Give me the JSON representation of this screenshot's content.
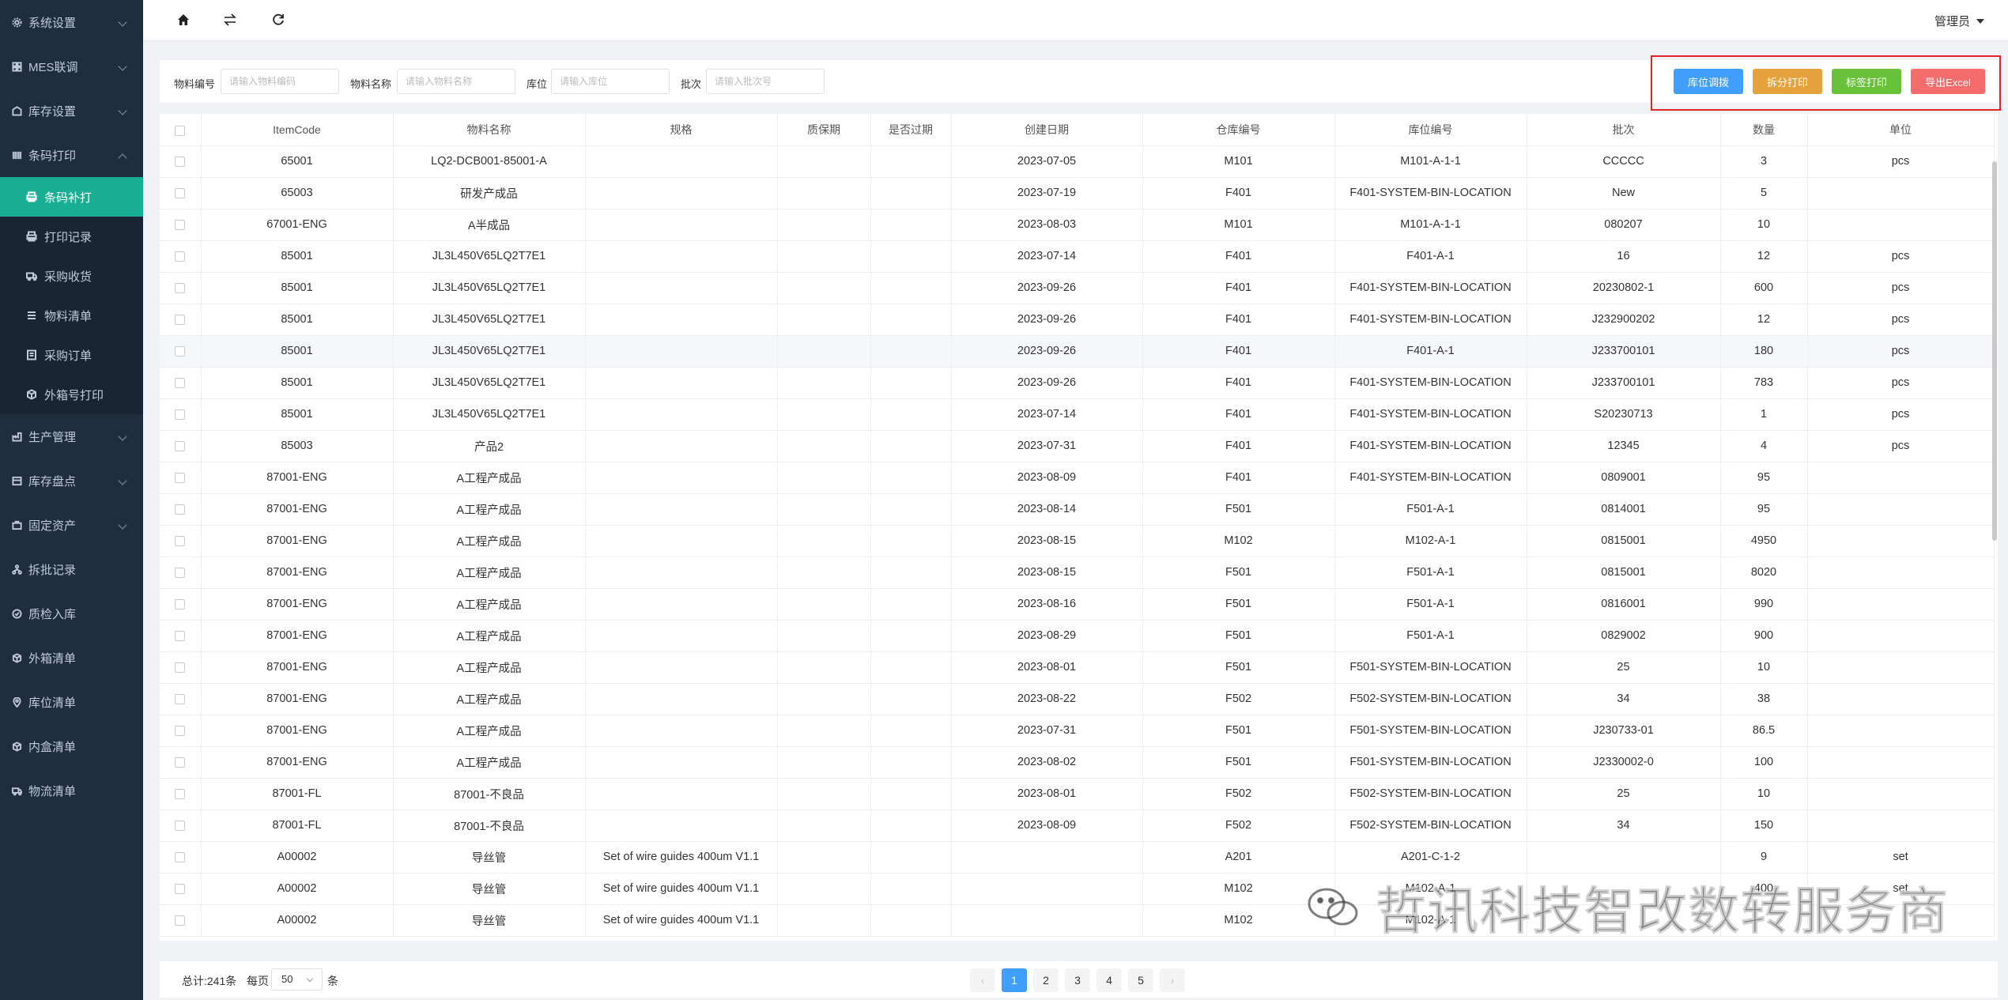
{
  "sidebar": {
    "items": [
      {
        "label": "系统设置",
        "icon": "gear-icon"
      },
      {
        "label": "MES联调",
        "icon": "grid-icon"
      },
      {
        "label": "库存设置",
        "icon": "store-icon"
      },
      {
        "label": "条码打印",
        "icon": "barcode-icon"
      },
      {
        "label": "条码补打",
        "icon": "print-icon",
        "sub": true,
        "active": true
      },
      {
        "label": "打印记录",
        "icon": "print-icon",
        "sub": true
      },
      {
        "label": "采购收货",
        "icon": "truck-icon",
        "sub": true
      },
      {
        "label": "物料清单",
        "icon": "list-icon",
        "sub": true
      },
      {
        "label": "采购订单",
        "icon": "order-icon",
        "sub": true
      },
      {
        "label": "外箱号打印",
        "icon": "box-icon",
        "sub": true
      },
      {
        "label": "生产管理",
        "icon": "factory-icon"
      },
      {
        "label": "库存盘点",
        "icon": "inventory-icon"
      },
      {
        "label": "固定资产",
        "icon": "asset-icon"
      },
      {
        "label": "拆批记录",
        "icon": "split-icon"
      },
      {
        "label": "质检入库",
        "icon": "check-icon"
      },
      {
        "label": "外箱清单",
        "icon": "box-icon"
      },
      {
        "label": "库位清单",
        "icon": "location-icon"
      },
      {
        "label": "内盒清单",
        "icon": "cube-icon"
      },
      {
        "label": "物流清单",
        "icon": "truck-icon"
      }
    ]
  },
  "topbar": {
    "icons": [
      "home-icon",
      "switch-icon",
      "refresh-icon"
    ],
    "user": "管理员"
  },
  "filters": {
    "code_label": "物料编号",
    "code_placeholder": "请输入物料编码",
    "name_label": "物料名称",
    "name_placeholder": "请输入物料名称",
    "loc_label": "库位",
    "loc_placeholder": "请输入库位",
    "batch_label": "批次",
    "batch_placeholder": "请输入批次号"
  },
  "buttons": {
    "transfer": "库位调拨",
    "split_print": "拆分打印",
    "label_print": "标签打印",
    "export": "导出Excel"
  },
  "colors": {
    "transfer": "#409eff",
    "split_print": "#e6a23c",
    "label_print": "#67c23a",
    "export": "#f56c6c",
    "sidebar_bg": "#1f2d3d",
    "active": "#1aae94",
    "highlight": "#e0262b"
  },
  "table": {
    "columns": [
      "ItemCode",
      "物料名称",
      "规格",
      "质保期",
      "是否过期",
      "创建日期",
      "仓库编号",
      "库位编号",
      "批次",
      "数量",
      "单位"
    ],
    "rows": [
      [
        "65001",
        "LQ2-DCB001-85001-A",
        "",
        "",
        "",
        "2023-07-05",
        "M101",
        "M101-A-1-1",
        "CCCCC",
        "3",
        "pcs"
      ],
      [
        "65003",
        "研发产成品",
        "",
        "",
        "",
        "2023-07-19",
        "F401",
        "F401-SYSTEM-BIN-LOCATION",
        "New",
        "5",
        ""
      ],
      [
        "67001-ENG",
        "A半成品",
        "",
        "",
        "",
        "2023-08-03",
        "M101",
        "M101-A-1-1",
        "080207",
        "10",
        ""
      ],
      [
        "85001",
        "JL3L450V65LQ2T7E1",
        "",
        "",
        "",
        "2023-07-14",
        "F401",
        "F401-A-1",
        "16",
        "12",
        "pcs"
      ],
      [
        "85001",
        "JL3L450V65LQ2T7E1",
        "",
        "",
        "",
        "2023-09-26",
        "F401",
        "F401-SYSTEM-BIN-LOCATION",
        "20230802-1",
        "600",
        "pcs"
      ],
      [
        "85001",
        "JL3L450V65LQ2T7E1",
        "",
        "",
        "",
        "2023-09-26",
        "F401",
        "F401-SYSTEM-BIN-LOCATION",
        "J232900202",
        "12",
        "pcs"
      ],
      [
        "85001",
        "JL3L450V65LQ2T7E1",
        "",
        "",
        "",
        "2023-09-26",
        "F401",
        "F401-A-1",
        "J233700101",
        "180",
        "pcs"
      ],
      [
        "85001",
        "JL3L450V65LQ2T7E1",
        "",
        "",
        "",
        "2023-09-26",
        "F401",
        "F401-SYSTEM-BIN-LOCATION",
        "J233700101",
        "783",
        "pcs"
      ],
      [
        "85001",
        "JL3L450V65LQ2T7E1",
        "",
        "",
        "",
        "2023-07-14",
        "F401",
        "F401-SYSTEM-BIN-LOCATION",
        "S20230713",
        "1",
        "pcs"
      ],
      [
        "85003",
        "产品2",
        "",
        "",
        "",
        "2023-07-31",
        "F401",
        "F401-SYSTEM-BIN-LOCATION",
        "12345",
        "4",
        "pcs"
      ],
      [
        "87001-ENG",
        "A工程产成品",
        "",
        "",
        "",
        "2023-08-09",
        "F401",
        "F401-SYSTEM-BIN-LOCATION",
        "0809001",
        "95",
        ""
      ],
      [
        "87001-ENG",
        "A工程产成品",
        "",
        "",
        "",
        "2023-08-14",
        "F501",
        "F501-A-1",
        "0814001",
        "95",
        ""
      ],
      [
        "87001-ENG",
        "A工程产成品",
        "",
        "",
        "",
        "2023-08-15",
        "M102",
        "M102-A-1",
        "0815001",
        "4950",
        ""
      ],
      [
        "87001-ENG",
        "A工程产成品",
        "",
        "",
        "",
        "2023-08-15",
        "F501",
        "F501-A-1",
        "0815001",
        "8020",
        ""
      ],
      [
        "87001-ENG",
        "A工程产成品",
        "",
        "",
        "",
        "2023-08-16",
        "F501",
        "F501-A-1",
        "0816001",
        "990",
        ""
      ],
      [
        "87001-ENG",
        "A工程产成品",
        "",
        "",
        "",
        "2023-08-29",
        "F501",
        "F501-A-1",
        "0829002",
        "900",
        ""
      ],
      [
        "87001-ENG",
        "A工程产成品",
        "",
        "",
        "",
        "2023-08-01",
        "F501",
        "F501-SYSTEM-BIN-LOCATION",
        "25",
        "10",
        ""
      ],
      [
        "87001-ENG",
        "A工程产成品",
        "",
        "",
        "",
        "2023-08-22",
        "F502",
        "F502-SYSTEM-BIN-LOCATION",
        "34",
        "38",
        ""
      ],
      [
        "87001-ENG",
        "A工程产成品",
        "",
        "",
        "",
        "2023-07-31",
        "F501",
        "F501-SYSTEM-BIN-LOCATION",
        "J230733-01",
        "86.5",
        ""
      ],
      [
        "87001-ENG",
        "A工程产成品",
        "",
        "",
        "",
        "2023-08-02",
        "F501",
        "F501-SYSTEM-BIN-LOCATION",
        "J2330002-0",
        "100",
        ""
      ],
      [
        "87001-FL",
        "87001-不良品",
        "",
        "",
        "",
        "2023-08-01",
        "F502",
        "F502-SYSTEM-BIN-LOCATION",
        "25",
        "10",
        ""
      ],
      [
        "87001-FL",
        "87001-不良品",
        "",
        "",
        "",
        "2023-08-09",
        "F502",
        "F502-SYSTEM-BIN-LOCATION",
        "34",
        "150",
        ""
      ],
      [
        "A00002",
        "导丝管",
        "Set of wire guides 400um V1.1",
        "",
        "",
        "",
        "A201",
        "A201-C-1-2",
        "",
        "9",
        "set"
      ],
      [
        "A00002",
        "导丝管",
        "Set of wire guides 400um V1.1",
        "",
        "",
        "",
        "M102",
        "M102-A-1",
        "",
        "400",
        "set"
      ],
      [
        "A00002",
        "导丝管",
        "Set of wire guides 400um V1.1",
        "",
        "",
        "",
        "M102",
        "M102-A-1",
        "",
        "",
        ""
      ]
    ]
  },
  "footer": {
    "total": "总计:241条",
    "per_page_label": "每页",
    "per_page_value": "50",
    "unit": "条",
    "pages": [
      "1",
      "2",
      "3",
      "4",
      "5"
    ],
    "prev": "‹",
    "next": "›"
  },
  "watermark": "哲讯科技智改数转服务商"
}
